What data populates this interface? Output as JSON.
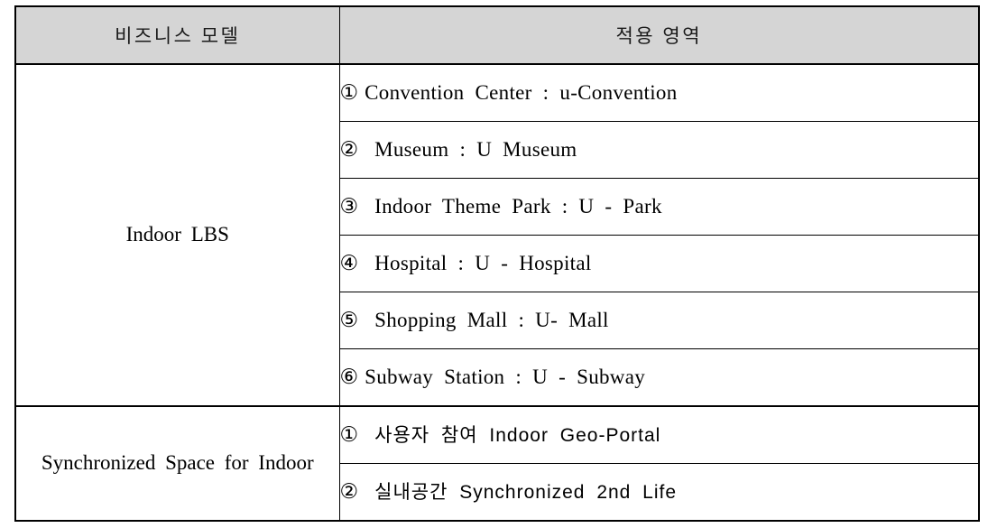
{
  "table": {
    "headers": {
      "model": "비즈니스 모델",
      "area": "적용 영역"
    },
    "sections": [
      {
        "model": "Indoor LBS",
        "rows": [
          {
            "num": "①",
            "text": "Convention Center : u-Convention",
            "gap": "tight",
            "korean": false
          },
          {
            "num": "②",
            "text": "Museum : U  Museum",
            "gap": "wide",
            "korean": false
          },
          {
            "num": "③",
            "text": "Indoor Theme Park : U - Park",
            "gap": "wide",
            "korean": false
          },
          {
            "num": "④",
            "text": "Hospital : U - Hospital",
            "gap": "wide",
            "korean": false
          },
          {
            "num": "⑤",
            "text": "Shopping Mall : U- Mall",
            "gap": "wide",
            "korean": false
          },
          {
            "num": "⑥",
            "text": "Subway Station : U - Subway",
            "gap": "tight",
            "korean": false
          }
        ]
      },
      {
        "model": "Synchronized Space for Indoor",
        "rows": [
          {
            "num": "①",
            "text": "사용자 참여 Indoor Geo-Portal",
            "gap": "wide",
            "korean": true
          },
          {
            "num": "②",
            "text": "실내공간 Synchronized 2nd Life",
            "gap": "wide",
            "korean": true
          }
        ]
      }
    ]
  },
  "colors": {
    "header_background": "#d5d5d5",
    "border": "#000000",
    "text": "#000000",
    "page_background": "#ffffff"
  }
}
